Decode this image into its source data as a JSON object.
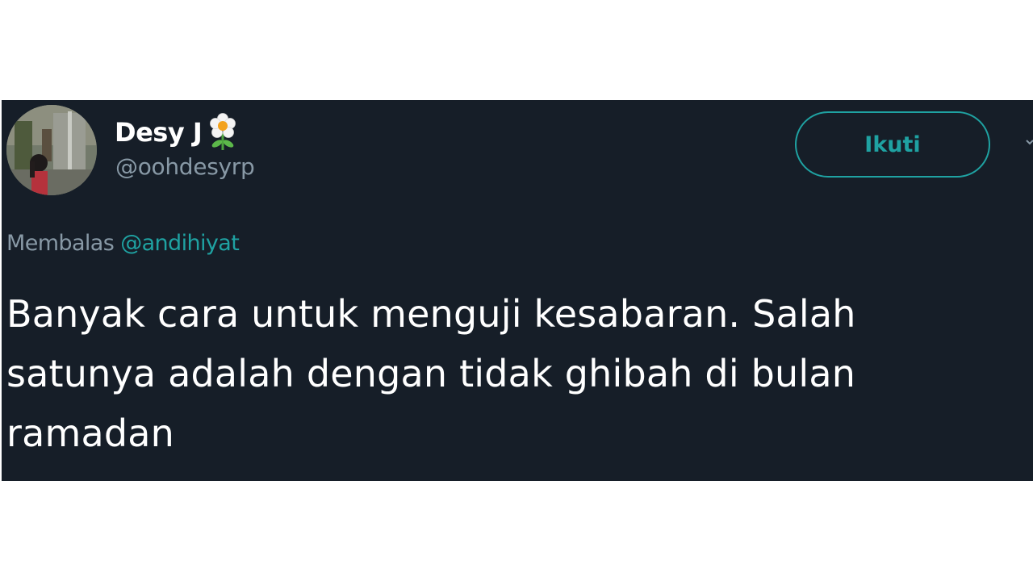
{
  "tweet": {
    "author": {
      "display_name": "Desy J",
      "handle": "@oohdesyrp",
      "avatar_icon": "profile-photo",
      "badge_icon": "flower-icon"
    },
    "follow_button_label": "Ikuti",
    "reply_context": {
      "prefix": "Membalas",
      "mention": "@andihiyat"
    },
    "text_lines": [
      "Banyak cara untuk menguji kesabaran. Salah",
      "satunya adalah dengan tidak ghibah di bulan",
      "ramadan"
    ]
  },
  "colors": {
    "card_background": "#161e28",
    "accent": "#1fa2a2",
    "secondary_text": "#8899a6",
    "primary_text": "#ffffff"
  }
}
